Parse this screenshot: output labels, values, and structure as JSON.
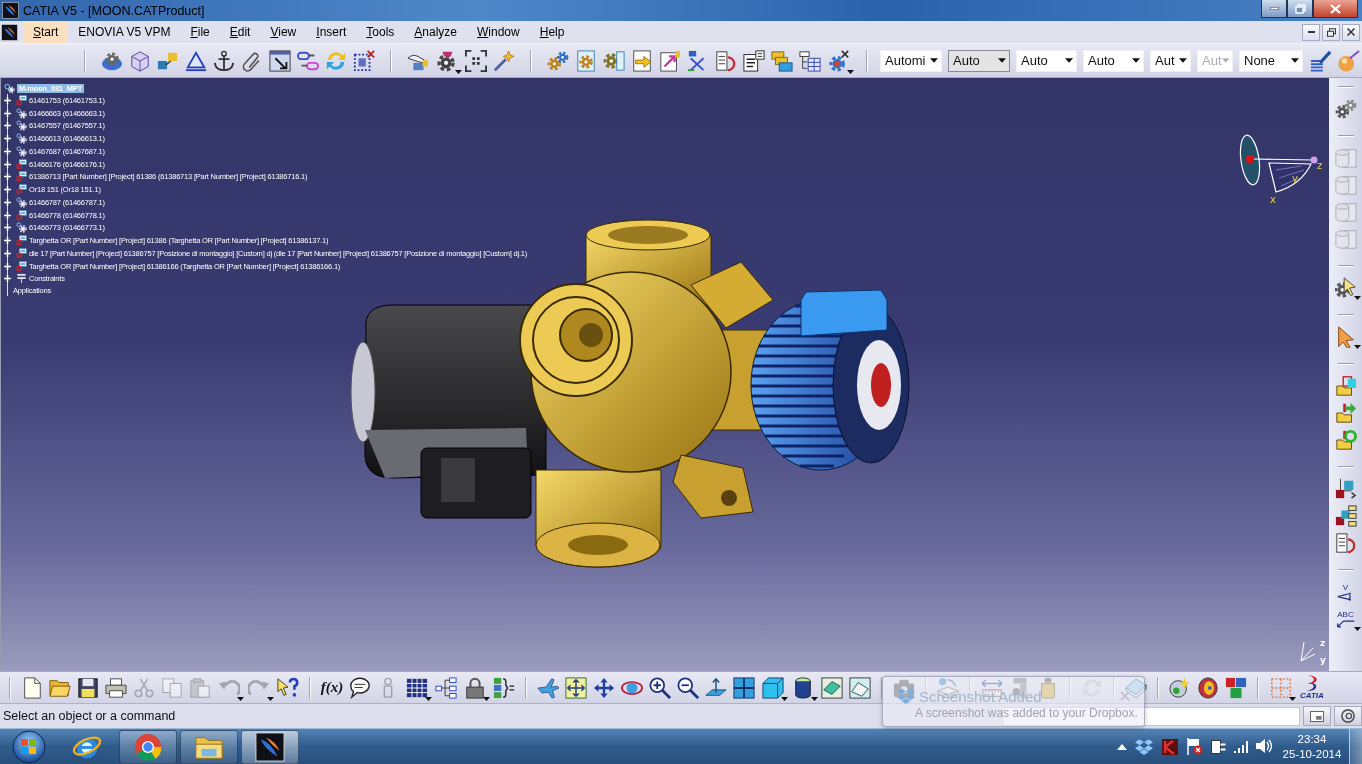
{
  "window": {
    "title": "CATIA V5 - [MOON.CATProduct]"
  },
  "menu": [
    {
      "label": "Start",
      "selected": true,
      "mnemonic": true
    },
    {
      "label": "ENOVIA V5 VPM",
      "selected": false,
      "mnemonic": false
    },
    {
      "label": "File",
      "selected": false,
      "mnemonic": true
    },
    {
      "label": "Edit",
      "selected": false,
      "mnemonic": true
    },
    {
      "label": "View",
      "selected": false,
      "mnemonic": true
    },
    {
      "label": "Insert",
      "selected": false,
      "mnemonic": true
    },
    {
      "label": "Tools",
      "selected": false,
      "mnemonic": true
    },
    {
      "label": "Analyze",
      "selected": false,
      "mnemonic": true
    },
    {
      "label": "Window",
      "selected": false,
      "mnemonic": true
    },
    {
      "label": "Help",
      "selected": false,
      "mnemonic": true
    }
  ],
  "top_toolbar": {
    "groups": [
      [
        {
          "kind": "gear-disc",
          "disabled": false,
          "dropdown": false
        },
        {
          "kind": "box",
          "disabled": false,
          "dropdown": false
        },
        {
          "kind": "blocks",
          "disabled": false,
          "dropdown": false
        },
        {
          "kind": "triangle",
          "disabled": false,
          "dropdown": false
        },
        {
          "kind": "anchor",
          "disabled": false,
          "dropdown": false
        },
        {
          "kind": "paperclip",
          "disabled": false,
          "dropdown": false
        },
        {
          "kind": "window-arrow",
          "disabled": false,
          "dropdown": false
        },
        {
          "kind": "links",
          "disabled": false,
          "dropdown": false
        },
        {
          "kind": "cycle",
          "disabled": false,
          "dropdown": false
        },
        {
          "kind": "grid-x",
          "disabled": false,
          "dropdown": false
        }
      ],
      [
        {
          "kind": "hand",
          "disabled": false,
          "dropdown": false
        },
        {
          "kind": "gear-cap",
          "disabled": false,
          "dropdown": true
        },
        {
          "kind": "frame",
          "disabled": false,
          "dropdown": false
        },
        {
          "kind": "wand",
          "disabled": false,
          "dropdown": false
        }
      ],
      [
        {
          "kind": "gears",
          "disabled": false,
          "dropdown": false
        },
        {
          "kind": "doc-gear",
          "disabled": false,
          "dropdown": false
        },
        {
          "kind": "gear-sheet",
          "disabled": false,
          "dropdown": false
        },
        {
          "kind": "doc-arrow",
          "disabled": false,
          "dropdown": false
        },
        {
          "kind": "doc-swap",
          "disabled": false,
          "dropdown": false
        },
        {
          "kind": "xarrows",
          "disabled": false,
          "dropdown": false
        },
        {
          "kind": "list-curve",
          "disabled": false,
          "dropdown": false
        },
        {
          "kind": "text-frame",
          "disabled": false,
          "dropdown": false
        },
        {
          "kind": "stack",
          "disabled": false,
          "dropdown": false
        },
        {
          "kind": "tree-table",
          "disabled": false,
          "dropdown": false
        },
        {
          "kind": "gear-x",
          "disabled": false,
          "dropdown": true
        }
      ]
    ],
    "combos": [
      {
        "value": "Automi",
        "focused": false,
        "disabled": false
      },
      {
        "value": "Auto",
        "focused": true,
        "disabled": false
      },
      {
        "value": "Auto",
        "focused": false,
        "disabled": false
      },
      {
        "value": "Auto",
        "focused": false,
        "disabled": false
      },
      {
        "value": "Aut",
        "focused": false,
        "disabled": false
      },
      {
        "value": "Aut",
        "focused": false,
        "disabled": true
      },
      {
        "value": "None",
        "focused": false,
        "disabled": false
      }
    ],
    "end_tools": [
      {
        "kind": "brush",
        "disabled": false,
        "dropdown": false
      },
      {
        "kind": "sphere-wand",
        "disabled": false,
        "dropdown": false
      }
    ]
  },
  "tree": {
    "label": "M-moon_031_MPT",
    "selected": true,
    "children": [
      {
        "kind": "assembly",
        "label": "61461753 (61461753.1)",
        "expanded": false
      },
      {
        "kind": "part",
        "label": "61466663 (61466663.1)",
        "expanded": false
      },
      {
        "kind": "part",
        "label": "61467557 (61467557.1)",
        "expanded": false
      },
      {
        "kind": "part",
        "label": "61466613 (61466613.1)",
        "expanded": false
      },
      {
        "kind": "part",
        "label": "61467687 (61467687.1)",
        "expanded": false
      },
      {
        "kind": "assembly",
        "label": "61466176 (61466176.1)",
        "expanded": false
      },
      {
        "kind": "assembly",
        "label": "61386713 [Part Number] [Project] 61386 (61386713 [Part Number] [Project] 61386716.1)",
        "expanded": false
      },
      {
        "kind": "assembly",
        "label": "Or18 151 (Or18 151.1)",
        "expanded": false
      },
      {
        "kind": "part",
        "label": "61466787 (61466787.1)",
        "expanded": false
      },
      {
        "kind": "assembly",
        "label": "61466778 (61466778.1)",
        "expanded": false
      },
      {
        "kind": "part",
        "label": "61466773 (61466773.1)",
        "expanded": false
      },
      {
        "kind": "assembly",
        "label": "Targhetta OR [Part Number] [Project] 61386 (Targhetta OR [Part Number] [Project] 61386137.1)",
        "expanded": false
      },
      {
        "kind": "assembly",
        "label": "dle 17 [Part Number] [Project] 61386757 [Posizione di montaggio] [Custom] dj (dle 17 [Part Number] [Project] 61386757 [Posizione di montaggio] [Custom] dj.1)",
        "expanded": false
      },
      {
        "kind": "assembly",
        "label": "Targhetta OR [Part Number] [Project] 61386166 (Targhetta OR [Part Number] [Project] 61386166.1)",
        "expanded": false
      },
      {
        "kind": "constraints",
        "label": "Constraints",
        "expanded": false
      }
    ],
    "applications": "Applications"
  },
  "compass": {
    "axis_labels": [
      "z",
      "y",
      "x"
    ]
  },
  "view_axes": {
    "axis_labels": [
      "z",
      "y"
    ]
  },
  "right_toolbar": {
    "groups": [
      [
        {
          "kind": "gear-pair",
          "disabled": false,
          "dropdown": false
        }
      ],
      [
        {
          "kind": "drum",
          "disabled": true,
          "dropdown": false
        },
        {
          "kind": "drum",
          "disabled": true,
          "dropdown": false
        },
        {
          "kind": "drum",
          "disabled": true,
          "dropdown": false
        },
        {
          "kind": "drum",
          "disabled": true,
          "dropdown": false
        }
      ],
      [
        {
          "kind": "gear-pointer",
          "disabled": false,
          "dropdown": true
        }
      ],
      [
        {
          "kind": "pointer",
          "disabled": false,
          "dropdown": true
        }
      ],
      [
        {
          "kind": "folder-shapes",
          "disabled": false,
          "dropdown": false
        },
        {
          "kind": "folder-arrow",
          "disabled": false,
          "dropdown": false
        },
        {
          "kind": "folder-cycle",
          "disabled": false,
          "dropdown": false
        }
      ],
      [
        {
          "kind": "cube-axes",
          "disabled": false,
          "dropdown": false
        },
        {
          "kind": "cube-list",
          "disabled": false,
          "dropdown": false
        },
        {
          "kind": "list-curve",
          "disabled": false,
          "dropdown": false
        }
      ],
      [
        {
          "kind": "angle",
          "label": "V",
          "disabled": false,
          "dropdown": false
        },
        {
          "kind": "text-arrow",
          "label": "ABC",
          "disabled": false,
          "dropdown": true
        }
      ]
    ]
  },
  "bottom_toolbar": {
    "groups": [
      [
        {
          "kind": "new",
          "disabled": false,
          "dropdown": false
        },
        {
          "kind": "open",
          "disabled": false,
          "dropdown": false
        },
        {
          "kind": "save",
          "disabled": false,
          "dropdown": false
        },
        {
          "kind": "print",
          "disabled": false,
          "dropdown": false
        },
        {
          "kind": "cut",
          "disabled": true,
          "dropdown": false
        },
        {
          "kind": "copy",
          "disabled": true,
          "dropdown": false
        },
        {
          "kind": "paste",
          "disabled": true,
          "dropdown": false
        },
        {
          "kind": "undo",
          "disabled": true,
          "dropdown": true
        },
        {
          "kind": "redo",
          "disabled": true,
          "dropdown": true
        },
        {
          "kind": "help",
          "disabled": false,
          "dropdown": false
        }
      ],
      [
        {
          "kind": "formula",
          "label": "f(x)",
          "disabled": false,
          "dropdown": false
        },
        {
          "kind": "comment",
          "disabled": false,
          "dropdown": false
        },
        {
          "kind": "figure",
          "disabled": true,
          "dropdown": false
        },
        {
          "kind": "table",
          "disabled": false,
          "dropdown": true
        },
        {
          "kind": "network",
          "disabled": false,
          "dropdown": false
        },
        {
          "kind": "lock",
          "disabled": false,
          "dropdown": true
        },
        {
          "kind": "param",
          "disabled": false,
          "dropdown": false
        }
      ],
      [
        {
          "kind": "fly",
          "disabled": false,
          "dropdown": false
        },
        {
          "kind": "fit",
          "disabled": false,
          "dropdown": false
        },
        {
          "kind": "pan",
          "disabled": false,
          "dropdown": false
        },
        {
          "kind": "rotate",
          "disabled": false,
          "dropdown": false
        },
        {
          "kind": "zoom-in",
          "disabled": false,
          "dropdown": false
        },
        {
          "kind": "zoom-out",
          "disabled": false,
          "dropdown": false
        },
        {
          "kind": "normal",
          "disabled": false,
          "dropdown": false
        },
        {
          "kind": "panes",
          "disabled": false,
          "dropdown": false
        },
        {
          "kind": "cube",
          "disabled": false,
          "dropdown": true
        },
        {
          "kind": "cylinder",
          "disabled": false,
          "dropdown": true
        },
        {
          "kind": "hide",
          "disabled": false,
          "dropdown": false
        },
        {
          "kind": "swap",
          "disabled": false,
          "dropdown": false
        }
      ],
      [
        {
          "kind": "camera",
          "disabled": false,
          "dropdown": false
        }
      ],
      [
        {
          "kind": "block-arrow",
          "disabled": false,
          "dropdown": false
        }
      ],
      [
        {
          "kind": "measure",
          "disabled": false,
          "dropdown": false
        },
        {
          "kind": "clamp",
          "disabled": false,
          "dropdown": false
        },
        {
          "kind": "weight",
          "disabled": false,
          "dropdown": false
        }
      ],
      [
        {
          "kind": "update",
          "disabled": true,
          "dropdown": false
        }
      ],
      [
        {
          "kind": "plate",
          "disabled": false,
          "dropdown": false
        }
      ],
      [
        {
          "kind": "sphere-star",
          "disabled": false,
          "dropdown": false
        },
        {
          "kind": "disc",
          "disabled": false,
          "dropdown": false
        },
        {
          "kind": "color-cubes",
          "disabled": false,
          "dropdown": false
        }
      ],
      [
        {
          "kind": "dot-grid",
          "disabled": false,
          "dropdown": true
        }
      ]
    ],
    "logo": "CATIA"
  },
  "status_bar": {
    "message": "Select an object or a command"
  },
  "notification": {
    "title": "Screenshot Added",
    "message": "A screenshot was added to your Dropbox."
  },
  "taskbar": {
    "apps": [
      {
        "kind": "globe",
        "open": false,
        "selected": false
      },
      {
        "kind": "ring",
        "open": true,
        "selected": false
      },
      {
        "kind": "folder",
        "open": true,
        "selected": false
      },
      {
        "kind": "flame",
        "open": true,
        "selected": true
      }
    ],
    "time": "23:34",
    "date": "25-10-2014"
  }
}
